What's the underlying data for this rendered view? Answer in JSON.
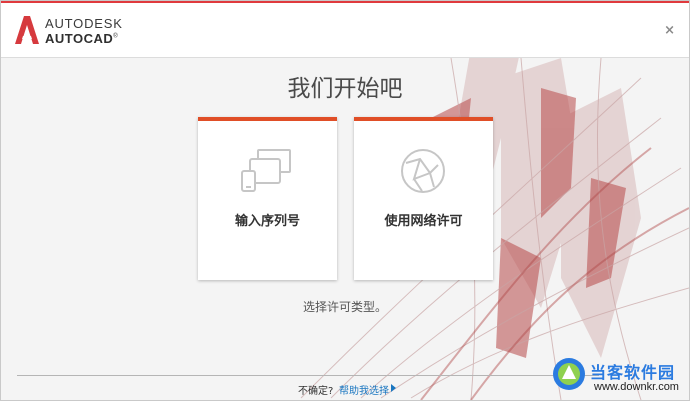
{
  "header": {
    "brand_top": "AUTODESK",
    "brand_bottom": "AUTOCAD",
    "brand_reg": "®",
    "close_label": "×"
  },
  "main": {
    "title": "我们开始吧",
    "cards": [
      {
        "label": "输入序列号",
        "icon": "devices-icon"
      },
      {
        "label": "使用网络许可",
        "icon": "network-globe-icon"
      }
    ],
    "hint": "选择许可类型。"
  },
  "footer": {
    "question": "不确定?",
    "link": "帮助我选择"
  },
  "watermark": {
    "name": "当客软件园",
    "url": "www.downkr.com"
  },
  "colors": {
    "accent": "#e04e27",
    "brand_red": "#d63a3e",
    "link": "#1a76c0",
    "watermark": "#2b7be0"
  }
}
